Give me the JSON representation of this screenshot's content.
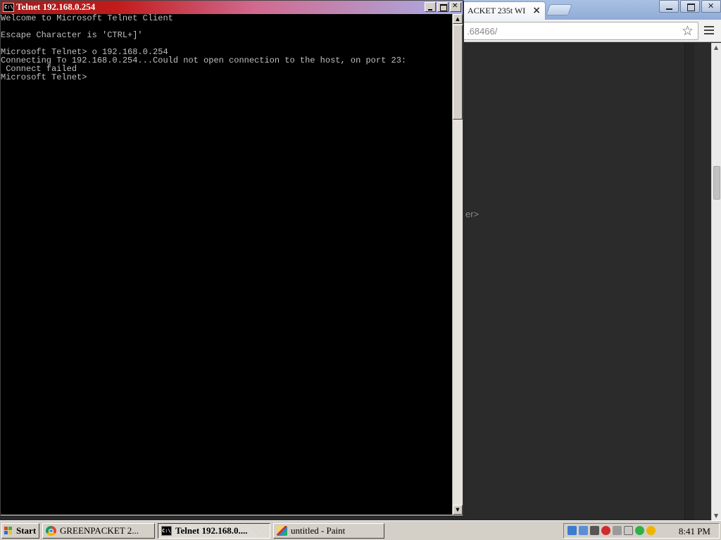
{
  "chrome": {
    "tab_title": "ACKET 235t WI",
    "tab_close": "×",
    "url": ".68466/",
    "editor_text": "er>"
  },
  "console": {
    "title": "Telnet 192.168.0.254",
    "icon_text": "C:\\",
    "lines": [
      "Welcome to Microsoft Telnet Client",
      "",
      "Escape Character is 'CTRL+]'",
      "",
      "Microsoft Telnet> o 192.168.0.254",
      "Connecting To 192.168.0.254...Could not open connection to the host, on port 23:",
      " Connect failed",
      "Microsoft Telnet>"
    ]
  },
  "taskbar": {
    "start_label": "Start",
    "tasks": [
      {
        "label": "GREENPACKET 2...",
        "icon": "chrome-icon"
      },
      {
        "label": "Telnet 192.168.0....",
        "icon": "console-icon"
      },
      {
        "label": "untitled - Paint",
        "icon": "paint-icon"
      }
    ],
    "clock": "8:41 PM"
  },
  "colors": {
    "console_bg": "#000000",
    "console_text": "#c0c0c0",
    "console_title_start": "#a11c1c",
    "console_title_end": "#a8aee8",
    "taskbar": "#d4d0c8"
  }
}
